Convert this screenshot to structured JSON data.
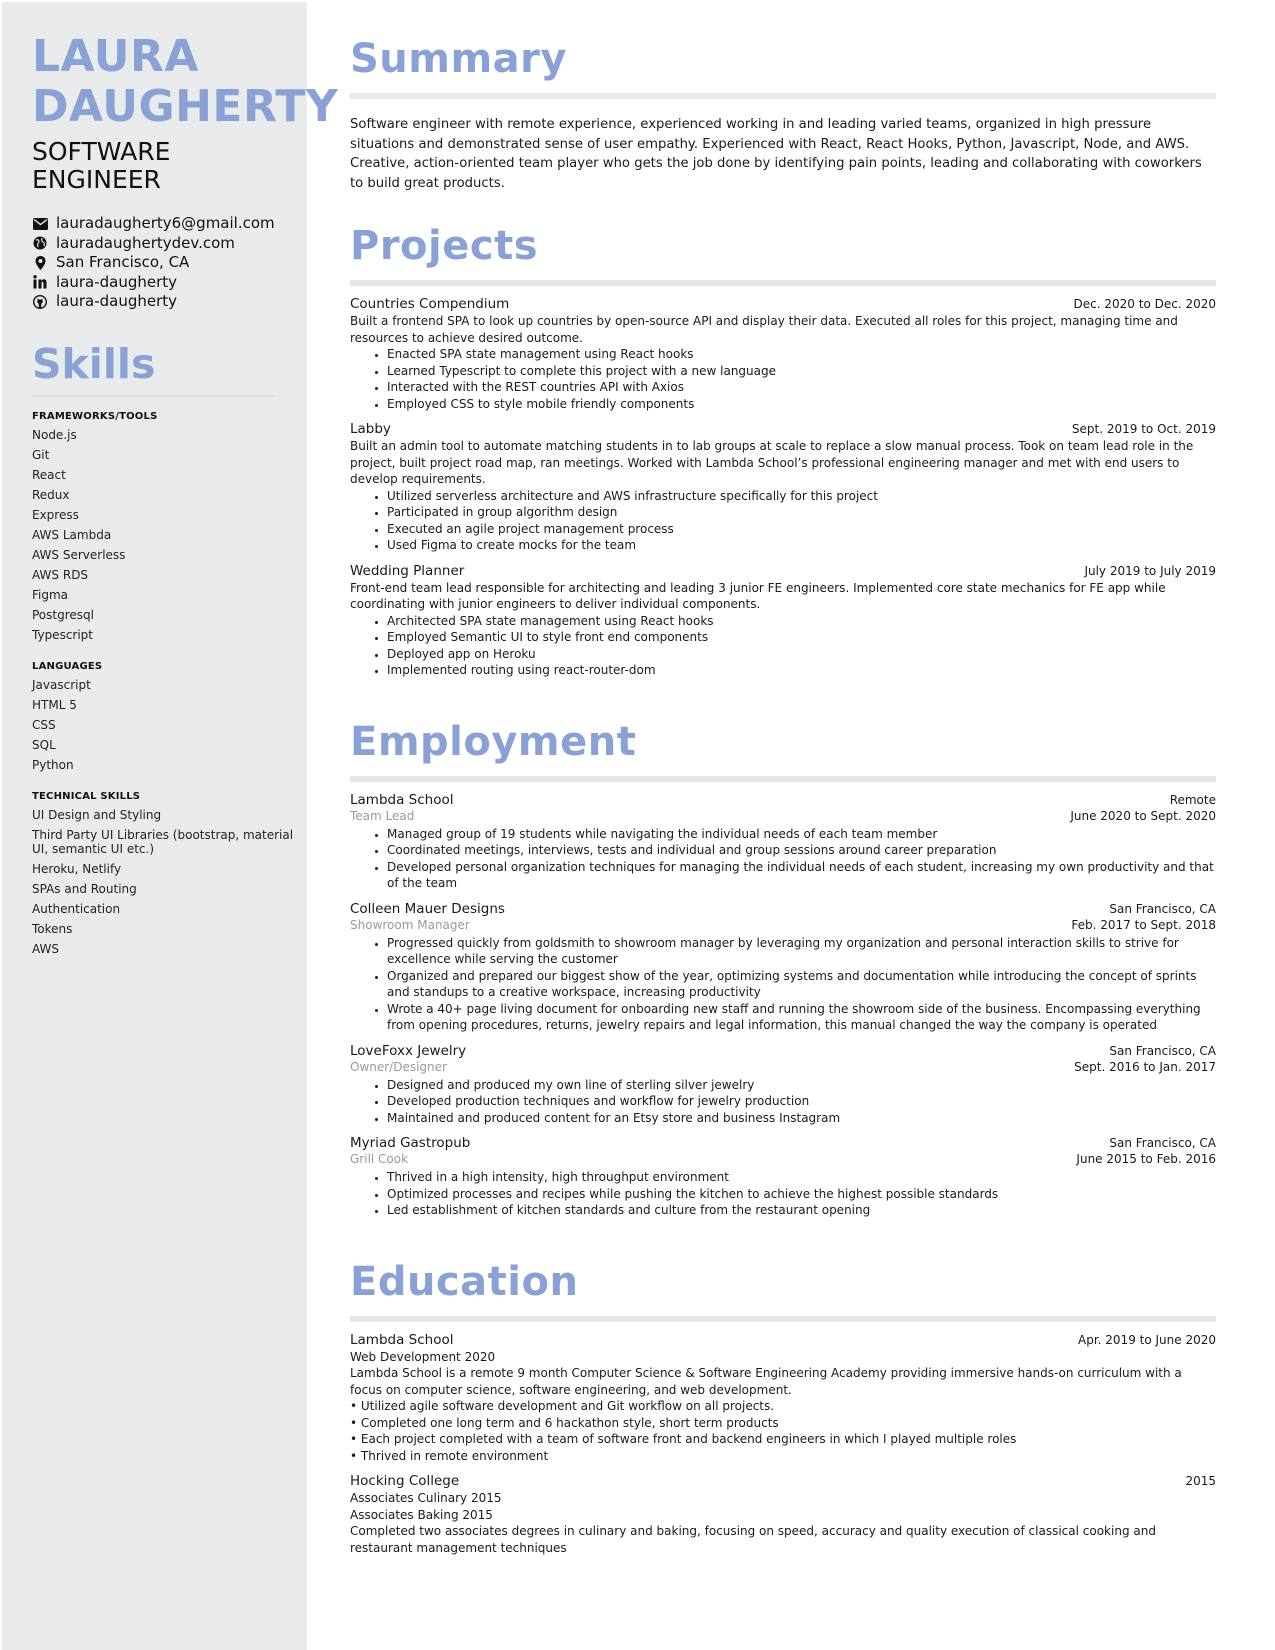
{
  "header": {
    "first_name": "LAURA",
    "last_name": "DAUGHERTY",
    "title_line1": "SOFTWARE",
    "title_line2": "ENGINEER"
  },
  "contact": [
    {
      "icon": "envelope-icon",
      "text": "lauradaugherty6@gmail.com"
    },
    {
      "icon": "globe-icon",
      "text": "lauradaughertydev.com"
    },
    {
      "icon": "map-pin-icon",
      "text": "San Francisco, CA"
    },
    {
      "icon": "linkedin-icon",
      "text": "laura-daugherty"
    },
    {
      "icon": "github-icon",
      "text": "laura-daugherty"
    }
  ],
  "skills": {
    "title": "Skills",
    "groups": [
      {
        "category": "FRAMEWORKS/TOOLS",
        "items": [
          "Node.js",
          "Git",
          "React",
          "Redux",
          "Express",
          "AWS Lambda",
          "AWS Serverless",
          "AWS RDS",
          "Figma",
          "Postgresql",
          "Typescript"
        ]
      },
      {
        "category": "LANGUAGES",
        "items": [
          "Javascript",
          "HTML 5",
          "CSS",
          "SQL",
          "Python"
        ]
      },
      {
        "category": "TECHNICAL SKILLS",
        "items": [
          "UI Design and Styling",
          "Third Party UI Libraries (bootstrap, material UI, semantic UI etc.)",
          "Heroku, Netlify",
          "SPAs and Routing",
          "Authentication",
          "Tokens",
          "AWS"
        ]
      }
    ]
  },
  "summary": {
    "title": "Summary",
    "text": "Software engineer with remote experience, experienced working in and leading varied teams, organized in high pressure situations and demonstrated sense of user empathy. Experienced with React, React Hooks, Python, Javascript, Node, and AWS. Creative, action-oriented team player who gets the job done by identifying pain points, leading and collaborating with coworkers to build great products."
  },
  "projects": {
    "title": "Projects",
    "items": [
      {
        "name": "Countries Compendium",
        "dates": "Dec. 2020 to Dec. 2020",
        "description": "Built a frontend SPA to look up countries by open-source API and display their data. Executed all roles for this project, managing time and resources to achieve desired outcome.",
        "bullets": [
          "Enacted SPA state management using React hooks",
          "Learned Typescript to complete this project with a new language",
          "Interacted with the REST countries API with Axios",
          "Employed CSS  to style mobile friendly components"
        ]
      },
      {
        "name": "Labby",
        "dates": "Sept. 2019 to Oct. 2019",
        "description": "Built an admin tool to automate matching students in to lab groups at scale to replace a slow manual process. Took on team lead role in the project, built project road map, ran meetings. Worked with Lambda School’s professional engineering manager and met with end users to develop requirements.",
        "bullets": [
          "Utilized serverless architecture and AWS infrastructure specifically for this project",
          "Participated in group algorithm design",
          "Executed an agile project management process",
          "Used Figma to create mocks for the team"
        ]
      },
      {
        "name": "Wedding Planner",
        "dates": "July 2019 to July 2019",
        "description": "Front-end team lead responsible for architecting and leading 3 junior FE engineers. Implemented core state mechanics for FE app while coordinating with junior engineers to deliver individual components.",
        "bullets": [
          "Architected SPA state management using React hooks",
          "Employed Semantic UI to style front end components",
          "Deployed app on Heroku",
          "Implemented routing using react-router-dom"
        ]
      }
    ]
  },
  "employment": {
    "title": "Employment",
    "items": [
      {
        "company": "Lambda School",
        "location": "Remote",
        "role": "Team Lead",
        "dates": "June 2020 to Sept. 2020",
        "bullets": [
          "Managed group of 19 students while navigating the individual needs of each team member",
          "Coordinated meetings, interviews, tests and individual and group sessions around career preparation",
          "Developed personal organization techniques for managing the individual needs of each student, increasing my own productivity and that of the team"
        ]
      },
      {
        "company": "Colleen Mauer Designs",
        "location": "San Francisco, CA",
        "role": "Showroom Manager",
        "dates": "Feb. 2017 to Sept. 2018",
        "bullets": [
          "Progressed quickly from goldsmith to showroom manager by leveraging my organization and personal interaction skills to strive for excellence while serving the customer",
          "Organized and prepared our biggest show of the year, optimizing systems and documentation while introducing the concept of sprints and standups to a creative workspace, increasing productivity",
          "Wrote a 40+ page living document for onboarding new staff and running the showroom side of the business. Encompassing everything from opening procedures, returns, jewelry repairs and legal information, this manual changed the way the company is operated"
        ]
      },
      {
        "company": "LoveFoxx Jewelry",
        "location": "San Francisco, CA",
        "role": "Owner/Designer",
        "dates": "Sept. 2016 to Jan. 2017",
        "bullets": [
          "Designed and produced my own line of sterling silver jewelry",
          "Developed production techniques and workflow for jewelry production",
          "Maintained and produced content for an Etsy store and business Instagram"
        ]
      },
      {
        "company": "Myriad Gastropub",
        "location": "San Francisco, CA",
        "role": "Grill Cook",
        "dates": "June 2015 to Feb. 2016",
        "bullets": [
          "Thrived in a high intensity, high throughput environment",
          "Optimized processes and recipes while pushing the kitchen to achieve the highest possible standards",
          "Led establishment of kitchen standards and culture from the restaurant opening"
        ]
      }
    ]
  },
  "education": {
    "title": "Education",
    "items": [
      {
        "school": "Lambda School",
        "dates": "Apr. 2019 to June 2020",
        "lines": [
          "Web Development 2020",
          "Lambda School is a remote 9 month Computer Science & Software Engineering Academy providing immersive hands-on curriculum with a focus on computer science, software engineering, and web development.",
          "• Utilized agile software development and Git workflow on all projects.",
          "• Completed one long term and 6 hackathon style, short term products",
          "• Each project completed with a team of software front and backend engineers in which I played multiple roles",
          "• Thrived in remote environment"
        ]
      },
      {
        "school": "Hocking College",
        "dates": "2015",
        "lines": [
          "Associates Culinary 2015",
          "Associates Baking 2015",
          "Completed two associates degrees in culinary and baking, focusing on speed, accuracy and quality execution of classical cooking and restaurant management techniques"
        ]
      }
    ]
  }
}
